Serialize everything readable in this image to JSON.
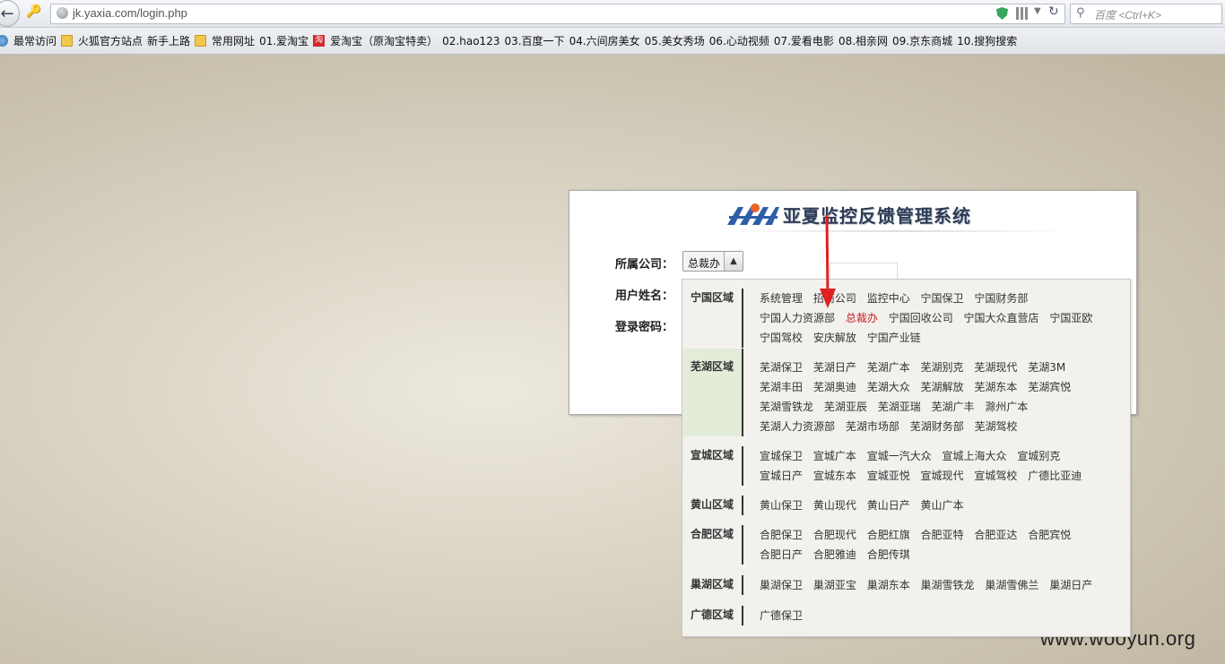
{
  "browser": {
    "url": "jk.yaxia.com/login.php",
    "search_placeholder": "百度 <Ctrl+K>"
  },
  "bookmarks": [
    {
      "label": "最常访问",
      "icon": "globe"
    },
    {
      "label": "火狐官方站点",
      "icon": "folder"
    },
    {
      "label": "新手上路",
      "icon": "page"
    },
    {
      "label": "常用网址",
      "icon": "folder"
    },
    {
      "label": "01.爱淘宝",
      "icon": "page"
    },
    {
      "label": "爱淘宝（原淘宝特卖）",
      "icon": "tao"
    },
    {
      "label": "02.hao123",
      "icon": "page"
    },
    {
      "label": "03.百度一下",
      "icon": "page"
    },
    {
      "label": "04.六间房美女",
      "icon": "page"
    },
    {
      "label": "05.美女秀场",
      "icon": "page"
    },
    {
      "label": "06.心动视频",
      "icon": "page"
    },
    {
      "label": "07.爱看电影",
      "icon": "page"
    },
    {
      "label": "08.相亲网",
      "icon": "page"
    },
    {
      "label": "09.京东商城",
      "icon": "page"
    },
    {
      "label": "10.搜狗搜索",
      "icon": "page"
    }
  ],
  "tao_glyph": "淘",
  "login": {
    "title": "亚夏监控反馈管理系统",
    "company_label": "所属公司：",
    "company_value": "总裁办",
    "username_label": "用户姓名：",
    "password_label": "登录密码："
  },
  "dropdown": [
    {
      "region": "宁国区域",
      "items": [
        "系统管理",
        "招商公司",
        "监控中心",
        "宁国保卫",
        "宁国财务部",
        "宁国人力资源部",
        "总裁办",
        "宁国回收公司",
        "宁国大众直营店",
        "宁国亚欧",
        "宁国驾校",
        "安庆解放",
        "宁国产业链"
      ]
    },
    {
      "region": "芜湖区域",
      "items": [
        "芜湖保卫",
        "芜湖日产",
        "芜湖广本",
        "芜湖别克",
        "芜湖现代",
        "芜湖3M",
        "芜湖丰田",
        "芜湖奥迪",
        "芜湖大众",
        "芜湖解放",
        "芜湖东本",
        "芜湖宾悦",
        "芜湖雪铁龙",
        "芜湖亚辰",
        "芜湖亚瑞",
        "芜湖广丰",
        "滁州广本",
        "芜湖人力资源部",
        "芜湖市场部",
        "芜湖财务部",
        "芜湖驾校"
      ]
    },
    {
      "region": "宣城区域",
      "items": [
        "宣城保卫",
        "宣城广本",
        "宣城一汽大众",
        "宣城上海大众",
        "宣城别克",
        "宣城日产",
        "宣城东本",
        "宣城亚悦",
        "宣城现代",
        "宣城驾校",
        "广德比亚迪"
      ]
    },
    {
      "region": "黄山区域",
      "items": [
        "黄山保卫",
        "黄山现代",
        "黄山日产",
        "黄山广本"
      ]
    },
    {
      "region": "合肥区域",
      "items": [
        "合肥保卫",
        "合肥现代",
        "合肥红旗",
        "合肥亚特",
        "合肥亚达",
        "合肥宾悦",
        "合肥日产",
        "合肥雅迪",
        "合肥传琪"
      ]
    },
    {
      "region": "巢湖区域",
      "items": [
        "巢湖保卫",
        "巢湖亚宝",
        "巢湖东本",
        "巢湖雪铁龙",
        "巢湖雪佛兰",
        "巢湖日产"
      ]
    },
    {
      "region": "广德区域",
      "items": [
        "广德保卫"
      ]
    }
  ],
  "selected_item": "总裁办",
  "highlighted_region": "芜湖区域",
  "watermark": "www.wooyun.org",
  "colors": {
    "selected_text": "#c21f1f",
    "arrow": "#e02020"
  }
}
